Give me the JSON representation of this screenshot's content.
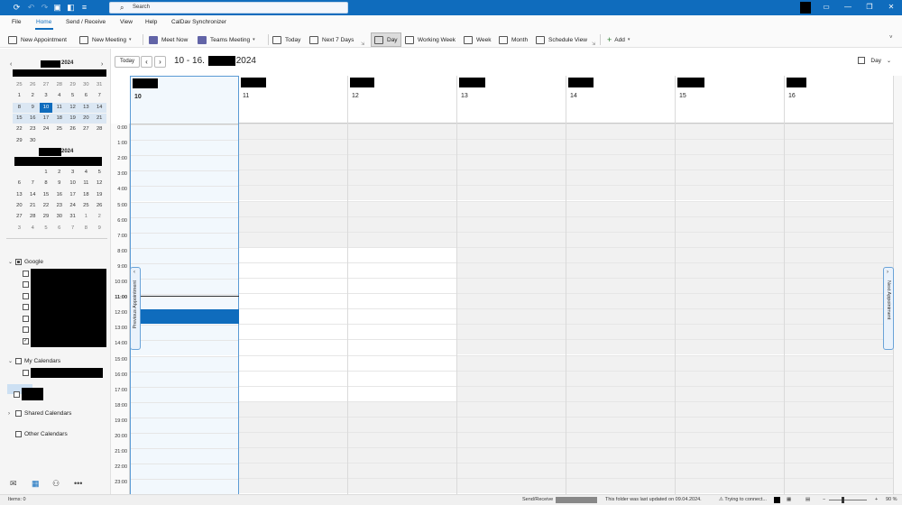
{
  "titlebar": {
    "search_placeholder": "Search"
  },
  "menu": {
    "tabs": [
      "File",
      "Home",
      "Send / Receive",
      "View",
      "Help",
      "CalDav Synchronizer"
    ]
  },
  "ribbon": {
    "new_appointment": "New Appointment",
    "new_meeting": "New Meeting",
    "meet_now": "Meet Now",
    "teams_meeting": "Teams Meeting",
    "today": "Today",
    "next7": "Next 7 Days",
    "day": "Day",
    "working_week": "Working Week",
    "week": "Week",
    "month": "Month",
    "schedule_view": "Schedule View",
    "add": "Add"
  },
  "mini_calendars": [
    {
      "title_year": "2024",
      "rows": [
        [
          "25",
          "26",
          "27",
          "28",
          "29",
          "30",
          "31"
        ],
        [
          "1",
          "2",
          "3",
          "4",
          "5",
          "6",
          "7"
        ],
        [
          "8",
          "9",
          "10",
          "11",
          "12",
          "13",
          "14"
        ],
        [
          "15",
          "16",
          "17",
          "18",
          "19",
          "20",
          "21"
        ],
        [
          "22",
          "23",
          "24",
          "25",
          "26",
          "27",
          "28"
        ],
        [
          "29",
          "30",
          "",
          "",
          "",
          "",
          ""
        ]
      ]
    },
    {
      "title_year": "2024",
      "rows": [
        [
          "",
          "",
          "1",
          "2",
          "3",
          "4",
          "5"
        ],
        [
          "6",
          "7",
          "8",
          "9",
          "10",
          "11",
          "12"
        ],
        [
          "13",
          "14",
          "15",
          "16",
          "17",
          "18",
          "19"
        ],
        [
          "20",
          "21",
          "22",
          "23",
          "24",
          "25",
          "26"
        ],
        [
          "27",
          "28",
          "29",
          "30",
          "31",
          "1",
          "2"
        ],
        [
          "3",
          "4",
          "5",
          "6",
          "7",
          "8",
          "9"
        ]
      ]
    }
  ],
  "folders": {
    "google": "Google",
    "my_calendars": "My Calendars",
    "shared_calendars": "Shared Calendars",
    "other_calendars": "Other Calendars"
  },
  "calendar": {
    "today_btn": "Today",
    "range_prefix": "10 - 16.",
    "range_year": "2024",
    "view_mode": "Day",
    "days": [
      "10",
      "11",
      "12",
      "13",
      "14",
      "15",
      "16"
    ],
    "hours": [
      "0:00",
      "1:00",
      "2:00",
      "3:00",
      "4:00",
      "5:00",
      "6:00",
      "7:00",
      "8:00",
      "9:00",
      "10:00",
      "11:00",
      "12:00",
      "13:00",
      "14:00",
      "15:00",
      "16:00",
      "17:00",
      "18:00",
      "19:00",
      "20:00",
      "21:00",
      "22:00",
      "23:00"
    ],
    "prev_appointment": "Previous Appointment",
    "next_appointment": "Next Appointment"
  },
  "status": {
    "items": "Items: 0",
    "send_receive": "Send/Receive",
    "last_updated": "This folder was last updated on 09.04.2024.",
    "trying": "Trying to connect...",
    "zoom": "90 %"
  }
}
